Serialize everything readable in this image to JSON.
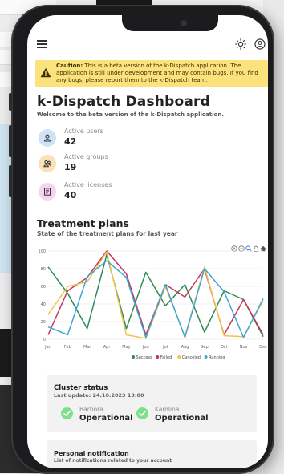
{
  "app": {
    "title": "k-Dispatch Dashboard",
    "subtitle": "Welcome to the beta version of the k-Dispatch application."
  },
  "appbar": {
    "menu_icon": "menu-icon",
    "theme_icon": "sun-icon",
    "account_icon": "user-circle-icon"
  },
  "banner": {
    "prefix": "Caution:",
    "text": " This is a beta version of the k-Dispatch application. The application is still under development and may contain bugs. If you find any bugs, please report them to the k-Dispatch team.",
    "icon": "warning-icon",
    "color": "#fce27d"
  },
  "stats": [
    {
      "label": "Active users",
      "value": "42",
      "icon": "user-icon",
      "color": "#cfe3f6"
    },
    {
      "label": "Active groups",
      "value": "19",
      "icon": "group-icon",
      "color": "#fbe1b8"
    },
    {
      "label": "Active licenses",
      "value": "40",
      "icon": "license-icon",
      "color": "#f6d3ee"
    }
  ],
  "treatment": {
    "title": "Treatment plans",
    "subtitle": "State of the treatment plans for last year",
    "tools": [
      "zoom-in-icon",
      "zoom-out-icon",
      "search-icon",
      "pan-hand-icon",
      "home-icon"
    ]
  },
  "chart_data": {
    "type": "line",
    "categories": [
      "Jan",
      "Feb",
      "Mar",
      "Apr",
      "May",
      "Jun",
      "Jul",
      "Aug",
      "Sep",
      "Oct",
      "Nov",
      "Dec"
    ],
    "ylim": [
      0,
      100
    ],
    "yticks": [
      "0",
      "20",
      "40",
      "60",
      "80",
      "100"
    ],
    "grid": true,
    "legend_position": "bottom",
    "series": [
      {
        "name": "Success",
        "color": "#2e8b57",
        "values": [
          82,
          52,
          12,
          96,
          12,
          76,
          38,
          62,
          8,
          55,
          45,
          3
        ]
      },
      {
        "name": "Failed",
        "color": "#c0395a",
        "values": [
          5,
          55,
          70,
          100,
          74,
          5,
          62,
          48,
          80,
          5,
          45,
          5
        ]
      },
      {
        "name": "Canceled",
        "color": "#f2c34c",
        "values": [
          28,
          60,
          65,
          99,
          5,
          1,
          60,
          3,
          82,
          4,
          3,
          44
        ]
      },
      {
        "name": "Running",
        "color": "#3fa7d6",
        "values": [
          14,
          5,
          71,
          89,
          70,
          2,
          62,
          2,
          80,
          54,
          2,
          46
        ]
      }
    ]
  },
  "cluster": {
    "title": "Cluster status",
    "updated": "Last update: 24.10.2023 13:00",
    "nodes": [
      {
        "name": "Barbora",
        "state": "Operational"
      },
      {
        "name": "Karolina",
        "state": "Operational"
      }
    ]
  },
  "notification": {
    "title": "Personal notification",
    "subtitle": "List of notifications related to your account"
  }
}
